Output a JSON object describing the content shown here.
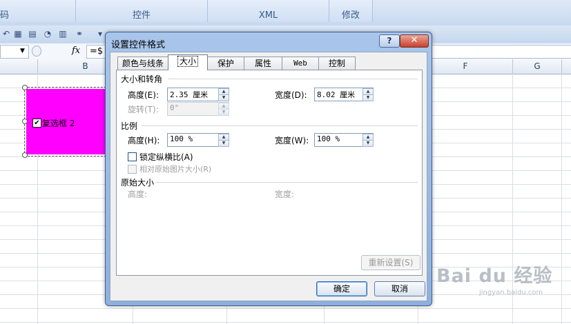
{
  "ribbon": {
    "groups": [
      {
        "label": "码"
      },
      {
        "label": "控件"
      },
      {
        "label": "XML"
      },
      {
        "label": "修改"
      }
    ]
  },
  "formula_bar": {
    "fx_label": "fx",
    "formula_text": "=$"
  },
  "sheet": {
    "columns": [
      "B",
      "F",
      "G"
    ]
  },
  "shape": {
    "checkbox_label": "复选框 2",
    "checked_mark": "✔",
    "fill_color": "#ff00ff"
  },
  "dialog": {
    "title": "设置控件格式",
    "help_button": "?",
    "close_button": "✕",
    "tabs": [
      "颜色与线条",
      "大小",
      "保护",
      "属性",
      "Web",
      "控制"
    ],
    "active_tab": "大小",
    "size_rotate": {
      "section_title": "大小和转角",
      "height_label": "高度(E):",
      "height_value": "2.35 厘米",
      "width_label": "宽度(D):",
      "width_value": "8.02 厘米",
      "rotate_label": "旋转(T):",
      "rotate_value": "0°"
    },
    "scale": {
      "section_title": "比例",
      "height_label": "高度(H):",
      "height_value": "100 %",
      "width_label": "宽度(W):",
      "width_value": "100 %",
      "lock_aspect_label": "锁定纵横比(A)",
      "relative_label": "相对原始图片大小(R)"
    },
    "original_size": {
      "section_title": "原始大小",
      "height_label": "高度:",
      "width_label": "宽度:"
    },
    "reset_button": "重新设置(S)",
    "ok_button": "确定",
    "cancel_button": "取消"
  },
  "watermark": {
    "logo": "Bai du 经验",
    "sub": "jingyan.baidu.com"
  }
}
